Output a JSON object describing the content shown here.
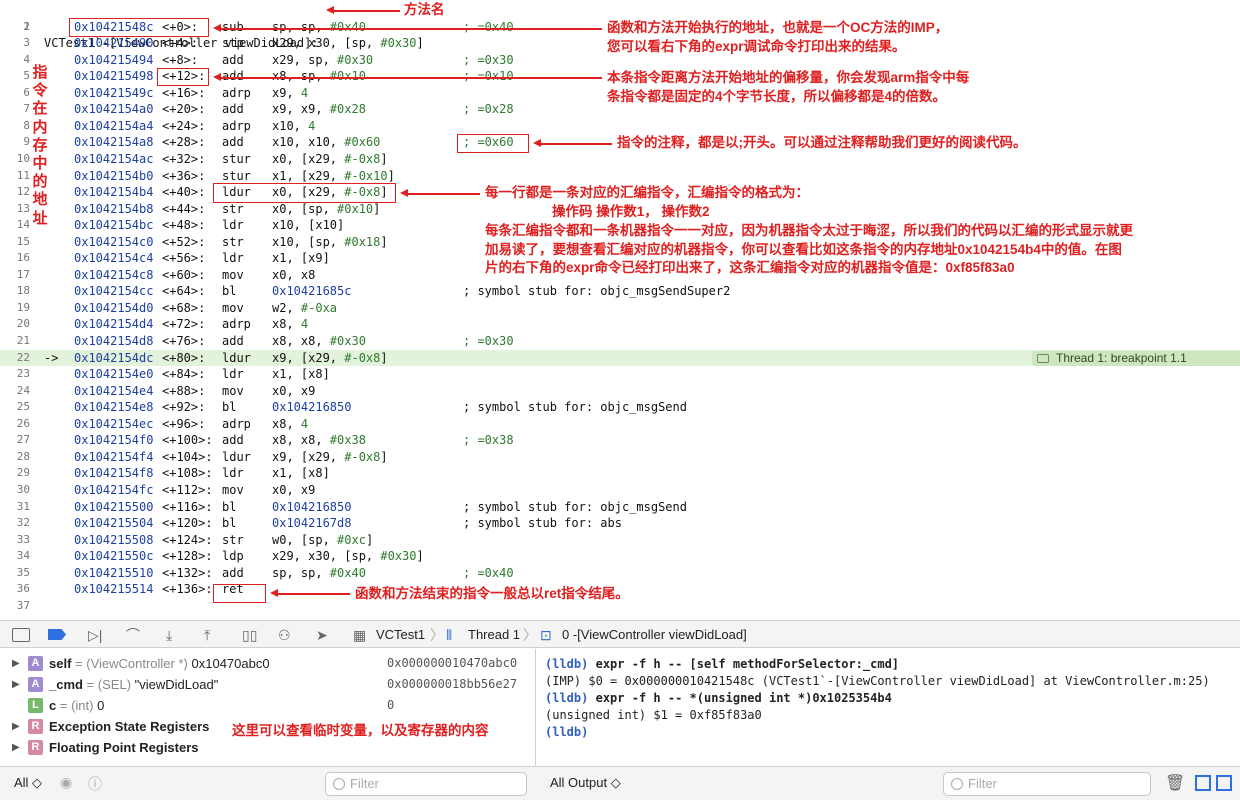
{
  "method_title": "VCTest1`-[ViewController viewDidLoad]:",
  "lines": [
    {
      "n": "2",
      "addr": "0x10421548c",
      "off": "<+0>:",
      "mn": "sub",
      "ops": "sp, sp, ",
      "imm": "#0x40",
      "cm": "; =0x40"
    },
    {
      "n": "3",
      "addr": "0x104215490",
      "off": "<+4>:",
      "mn": "stp",
      "ops": "x29, x30, [sp, ",
      "imm": "#0x30",
      "tail": "]",
      "cm": ""
    },
    {
      "n": "4",
      "addr": "0x104215494",
      "off": "<+8>:",
      "mn": "add",
      "ops": "x29, sp, ",
      "imm": "#0x30",
      "cm": "; =0x30"
    },
    {
      "n": "5",
      "addr": "0x104215498",
      "off": "<+12>:",
      "mn": "add",
      "ops": "x8, sp, ",
      "imm": "#0x10",
      "cm": "; =0x10"
    },
    {
      "n": "6",
      "addr": "0x10421549c",
      "off": "<+16>:",
      "mn": "adrp",
      "ops": "x9, ",
      "imm": "4",
      "cm": ""
    },
    {
      "n": "7",
      "addr": "0x1042154a0",
      "off": "<+20>:",
      "mn": "add",
      "ops": "x9, x9, ",
      "imm": "#0x28",
      "cm": "; =0x28"
    },
    {
      "n": "8",
      "addr": "0x1042154a4",
      "off": "<+24>:",
      "mn": "adrp",
      "ops": "x10, ",
      "imm": "4",
      "cm": ""
    },
    {
      "n": "9",
      "addr": "0x1042154a8",
      "off": "<+28>:",
      "mn": "add",
      "ops": "x10, x10, ",
      "imm": "#0x60",
      "cm": "; =0x60"
    },
    {
      "n": "10",
      "addr": "0x1042154ac",
      "off": "<+32>:",
      "mn": "stur",
      "ops": "x0, [x29, ",
      "imm": "#-0x8",
      "tail": "]",
      "cm": ""
    },
    {
      "n": "11",
      "addr": "0x1042154b0",
      "off": "<+36>:",
      "mn": "stur",
      "ops": "x1, [x29, ",
      "imm": "#-0x10",
      "tail": "]",
      "cm": ""
    },
    {
      "n": "12",
      "addr": "0x1042154b4",
      "off": "<+40>:",
      "mn": "ldur",
      "ops": "x0, [x29, ",
      "imm": "#-0x8",
      "tail": "]",
      "cm": ""
    },
    {
      "n": "13",
      "addr": "0x1042154b8",
      "off": "<+44>:",
      "mn": "str",
      "ops": "x0, [sp, ",
      "imm": "#0x10",
      "tail": "]",
      "cm": ""
    },
    {
      "n": "14",
      "addr": "0x1042154bc",
      "off": "<+48>:",
      "mn": "ldr",
      "ops": "x10, [x10]",
      "cm": ""
    },
    {
      "n": "15",
      "addr": "0x1042154c0",
      "off": "<+52>:",
      "mn": "str",
      "ops": "x10, [sp, ",
      "imm": "#0x18",
      "tail": "]",
      "cm": ""
    },
    {
      "n": "16",
      "addr": "0x1042154c4",
      "off": "<+56>:",
      "mn": "ldr",
      "ops": "x1, [x9]",
      "cm": ""
    },
    {
      "n": "17",
      "addr": "0x1042154c8",
      "off": "<+60>:",
      "mn": "mov",
      "ops": "x0, x8",
      "cm": ""
    },
    {
      "n": "18",
      "addr": "0x1042154cc",
      "off": "<+64>:",
      "mn": "bl",
      "ops": "",
      "blue": "0x10421685c",
      "cm": "; symbol stub for: objc_msgSendSuper2"
    },
    {
      "n": "19",
      "addr": "0x1042154d0",
      "off": "<+68>:",
      "mn": "mov",
      "ops": "w2, ",
      "imm": "#-0xa",
      "cm": ""
    },
    {
      "n": "20",
      "addr": "0x1042154d4",
      "off": "<+72>:",
      "mn": "adrp",
      "ops": "x8, ",
      "imm": "4",
      "cm": ""
    },
    {
      "n": "21",
      "addr": "0x1042154d8",
      "off": "<+76>:",
      "mn": "add",
      "ops": "x8, x8, ",
      "imm": "#0x30",
      "cm": "; =0x30"
    },
    {
      "n": "22",
      "arrow": "->",
      "addr": "0x1042154dc",
      "off": "<+80>:",
      "mn": "ldur",
      "ops": "x9, [x29, ",
      "imm": "#-0x8",
      "tail": "]",
      "cm": "",
      "hl": true
    },
    {
      "n": "23",
      "addr": "0x1042154e0",
      "off": "<+84>:",
      "mn": "ldr",
      "ops": "x1, [x8]",
      "cm": ""
    },
    {
      "n": "24",
      "addr": "0x1042154e4",
      "off": "<+88>:",
      "mn": "mov",
      "ops": "x0, x9",
      "cm": ""
    },
    {
      "n": "25",
      "addr": "0x1042154e8",
      "off": "<+92>:",
      "mn": "bl",
      "ops": "",
      "blue": "0x104216850",
      "cm": "; symbol stub for: objc_msgSend"
    },
    {
      "n": "26",
      "addr": "0x1042154ec",
      "off": "<+96>:",
      "mn": "adrp",
      "ops": "x8, ",
      "imm": "4",
      "cm": ""
    },
    {
      "n": "27",
      "addr": "0x1042154f0",
      "off": "<+100>:",
      "mn": "add",
      "ops": "x8, x8, ",
      "imm": "#0x38",
      "cm": "; =0x38"
    },
    {
      "n": "28",
      "addr": "0x1042154f4",
      "off": "<+104>:",
      "mn": "ldur",
      "ops": "x9, [x29, ",
      "imm": "#-0x8",
      "tail": "]",
      "cm": ""
    },
    {
      "n": "29",
      "addr": "0x1042154f8",
      "off": "<+108>:",
      "mn": "ldr",
      "ops": "x1, [x8]",
      "cm": ""
    },
    {
      "n": "30",
      "addr": "0x1042154fc",
      "off": "<+112>:",
      "mn": "mov",
      "ops": "x0, x9",
      "cm": ""
    },
    {
      "n": "31",
      "addr": "0x104215500",
      "off": "<+116>:",
      "mn": "bl",
      "ops": "",
      "blue": "0x104216850",
      "cm": "; symbol stub for: objc_msgSend"
    },
    {
      "n": "32",
      "addr": "0x104215504",
      "off": "<+120>:",
      "mn": "bl",
      "ops": "",
      "blue": "0x1042167d8",
      "cm": "; symbol stub for: abs"
    },
    {
      "n": "33",
      "addr": "0x104215508",
      "off": "<+124>:",
      "mn": "str",
      "ops": "w0, [sp, ",
      "imm": "#0xc",
      "tail": "]",
      "cm": ""
    },
    {
      "n": "34",
      "addr": "0x10421550c",
      "off": "<+128>:",
      "mn": "ldp",
      "ops": "x29, x30, [sp, ",
      "imm": "#0x30",
      "tail": "]",
      "cm": ""
    },
    {
      "n": "35",
      "addr": "0x104215510",
      "off": "<+132>:",
      "mn": "add",
      "ops": "sp, sp, ",
      "imm": "#0x40",
      "cm": "; =0x40"
    },
    {
      "n": "36",
      "addr": "0x104215514",
      "off": "<+136>:",
      "mn": "ret",
      "ops": "",
      "cm": ""
    },
    {
      "n": "37",
      "addr": "",
      "off": "",
      "mn": "",
      "ops": "",
      "cm": ""
    }
  ],
  "thread_badge": "Thread 1: breakpoint 1.1",
  "annotations": {
    "method_name": "方法名",
    "imp_1": "函数和方法开始执行的地址，也就是一个OC方法的IMP，",
    "imp_2": "您可以看右下角的expr调试命令打印出来的结果。",
    "offset_1": "本条指令距离方法开始地址的偏移量，你会发现arm指令中每",
    "offset_2": "条指令都是固定的4个字节长度，所以偏移都是4的倍数。",
    "comment": "指令的注释，都是以;开头。可以通过注释帮助我们更好的阅读代码。",
    "asm_1": "每一行都是一条对应的汇编指令，汇编指令的格式为：",
    "asm_2": "操作码    操作数1，  操作数2",
    "asm_3": "每条汇编指令都和一条机器指令一一对应，因为机器指令太过于晦涩，所以我们的代码以汇编的形式显示就更",
    "asm_4": "加易读了，要想查看汇编对应的机器指令，你可以查看比如这条指令的内存地址0x1042154b4中的值。在图",
    "asm_5": "片的右下角的expr命令已经打印出来了，这条汇编指令对应的机器指令值是：0xf85f83a0",
    "ret": "函数和方法结束的指令一般总以ret指令结尾。",
    "vertical": "指令在内存中的地址",
    "vars": "这里可以查看临时变量，以及寄存器的内容"
  },
  "breadcrumb": {
    "target": "VCTest1",
    "thread": "Thread 1",
    "frame": "0 -[ViewController viewDidLoad]"
  },
  "variables": [
    {
      "badge": "A",
      "color": "#a08bd0",
      "name": "self",
      "type": "= (ViewController *)",
      "value": "0x10470abc0",
      "raw": "0x000000010470abc0",
      "expand": true
    },
    {
      "badge": "A",
      "color": "#a08bd0",
      "name": "_cmd",
      "type": "= (SEL)",
      "value": "\"viewDidLoad\"",
      "raw": "0x000000018bb56e27",
      "expand": true
    },
    {
      "badge": "L",
      "color": "#78b86a",
      "name": "c",
      "type": "= (int)",
      "value": "0",
      "raw": "0",
      "expand": false
    },
    {
      "badge": "R",
      "color": "#d48aa6",
      "name": "Exception State Registers",
      "type": "",
      "value": "",
      "raw": "",
      "expand": true
    },
    {
      "badge": "R",
      "color": "#d48aa6",
      "name": "Floating Point Registers",
      "type": "",
      "value": "",
      "raw": "",
      "expand": true
    }
  ],
  "console": {
    "prompt": "(lldb)",
    "cmd1": "expr -f h -- [self methodForSelector:_cmd]",
    "out1": "(IMP) $0 = 0x000000010421548c (VCTest1`-[ViewController viewDidLoad] at ViewController.m:25)",
    "cmd2": "expr -f h -- *(unsigned int *)0x1025354b4",
    "out2": "(unsigned int) $1 = 0xf85f83a0"
  },
  "bottom": {
    "scope": "All ◇",
    "output": "All Output ◇",
    "filter_placeholder": "Filter"
  }
}
